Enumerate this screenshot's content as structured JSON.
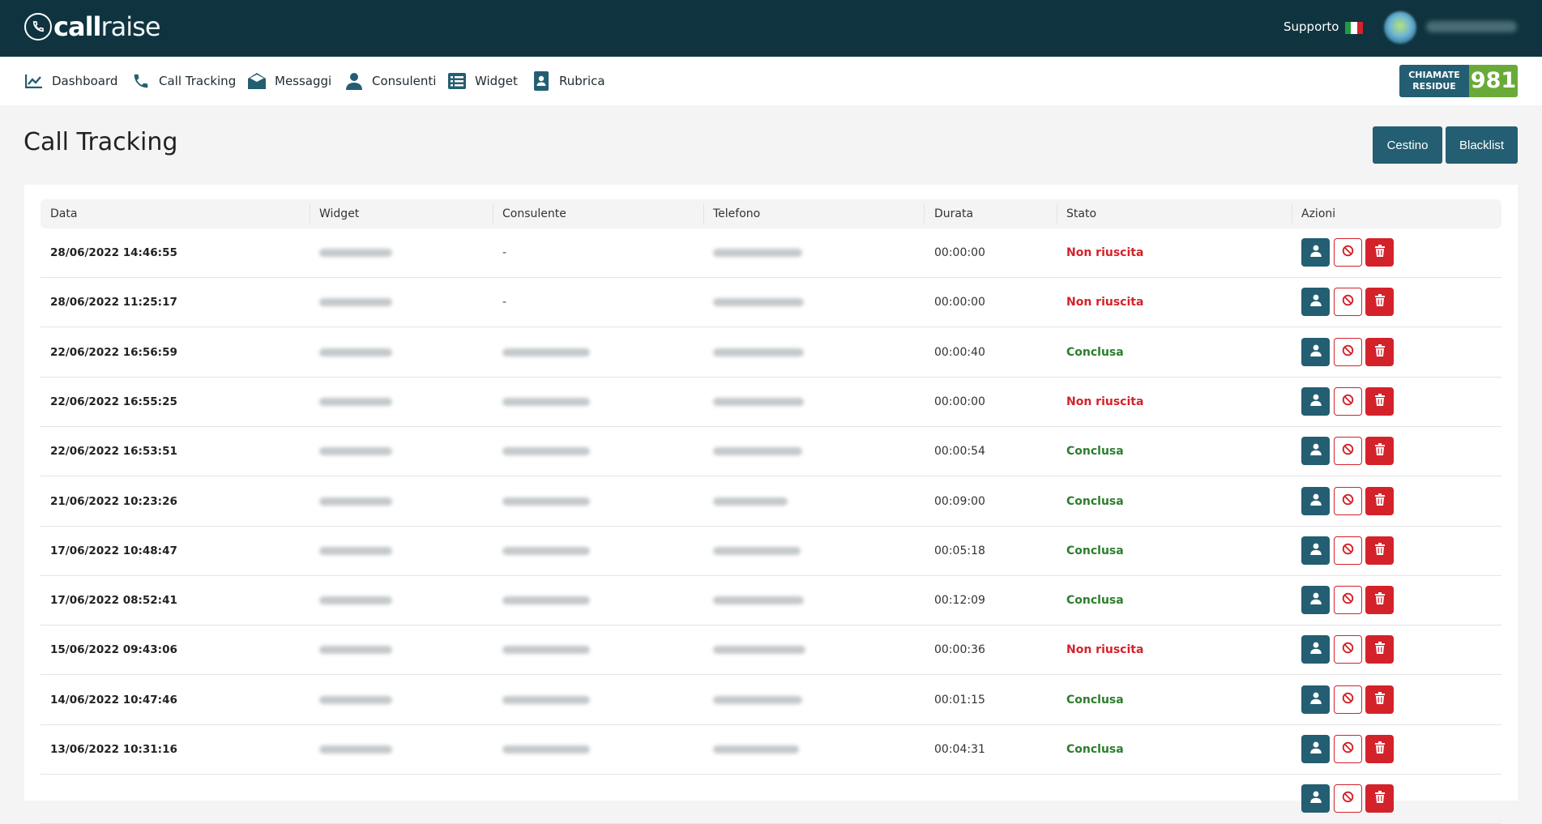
{
  "header": {
    "logo_bold": "call",
    "logo_light": "raise",
    "support": "Supporto",
    "flag_colors": [
      "#1f9e3b",
      "#ffffff",
      "#d4222a"
    ],
    "user_name": ""
  },
  "nav": {
    "items": [
      {
        "label": "Dashboard",
        "icon": "chart-line-icon"
      },
      {
        "label": "Call Tracking",
        "icon": "phone-icon"
      },
      {
        "label": "Messaggi",
        "icon": "envelope-open-icon"
      },
      {
        "label": "Consulenti",
        "icon": "user-icon"
      },
      {
        "label": "Widget",
        "icon": "list-icon"
      },
      {
        "label": "Rubrica",
        "icon": "address-book-icon"
      }
    ],
    "remaining_label_1": "CHIAMATE",
    "remaining_label_2": "RESIDUE",
    "remaining_value": "981"
  },
  "page": {
    "title": "Call Tracking",
    "cestino": "Cestino",
    "blacklist": "Blacklist"
  },
  "table": {
    "columns": [
      "Data",
      "Widget",
      "Consulente",
      "Telefono",
      "Durata",
      "Stato",
      "Azioni"
    ],
    "rows": [
      {
        "data": "28/06/2022 14:46:55",
        "consulente": "-",
        "durata": "00:00:00",
        "stato": "Non riuscita"
      },
      {
        "data": "28/06/2022 11:25:17",
        "consulente": "-",
        "durata": "00:00:00",
        "stato": "Non riuscita"
      },
      {
        "data": "22/06/2022 16:56:59",
        "consulente": "",
        "durata": "00:00:40",
        "stato": "Conclusa"
      },
      {
        "data": "22/06/2022 16:55:25",
        "consulente": "",
        "durata": "00:00:00",
        "stato": "Non riuscita"
      },
      {
        "data": "22/06/2022 16:53:51",
        "consulente": "",
        "durata": "00:00:54",
        "stato": "Conclusa"
      },
      {
        "data": "21/06/2022 10:23:26",
        "consulente": "",
        "durata": "00:09:00",
        "stato": "Conclusa"
      },
      {
        "data": "17/06/2022 10:48:47",
        "consulente": "",
        "durata": "00:05:18",
        "stato": "Conclusa"
      },
      {
        "data": "17/06/2022 08:52:41",
        "consulente": "",
        "durata": "00:12:09",
        "stato": "Conclusa"
      },
      {
        "data": "15/06/2022 09:43:06",
        "consulente": "",
        "durata": "00:00:36",
        "stato": "Non riuscita"
      },
      {
        "data": "14/06/2022 10:47:46",
        "consulente": "",
        "durata": "00:01:15",
        "stato": "Conclusa"
      },
      {
        "data": "13/06/2022 10:31:16",
        "consulente": "",
        "durata": "00:04:31",
        "stato": "Conclusa"
      },
      {
        "data": "",
        "consulente": "",
        "durata": "",
        "stato": ""
      }
    ]
  },
  "colors": {
    "topbar": "#0f3440",
    "primary": "#245e72",
    "green": "#6aaa38",
    "danger": "#d4222a",
    "success": "#2d7d2d"
  }
}
